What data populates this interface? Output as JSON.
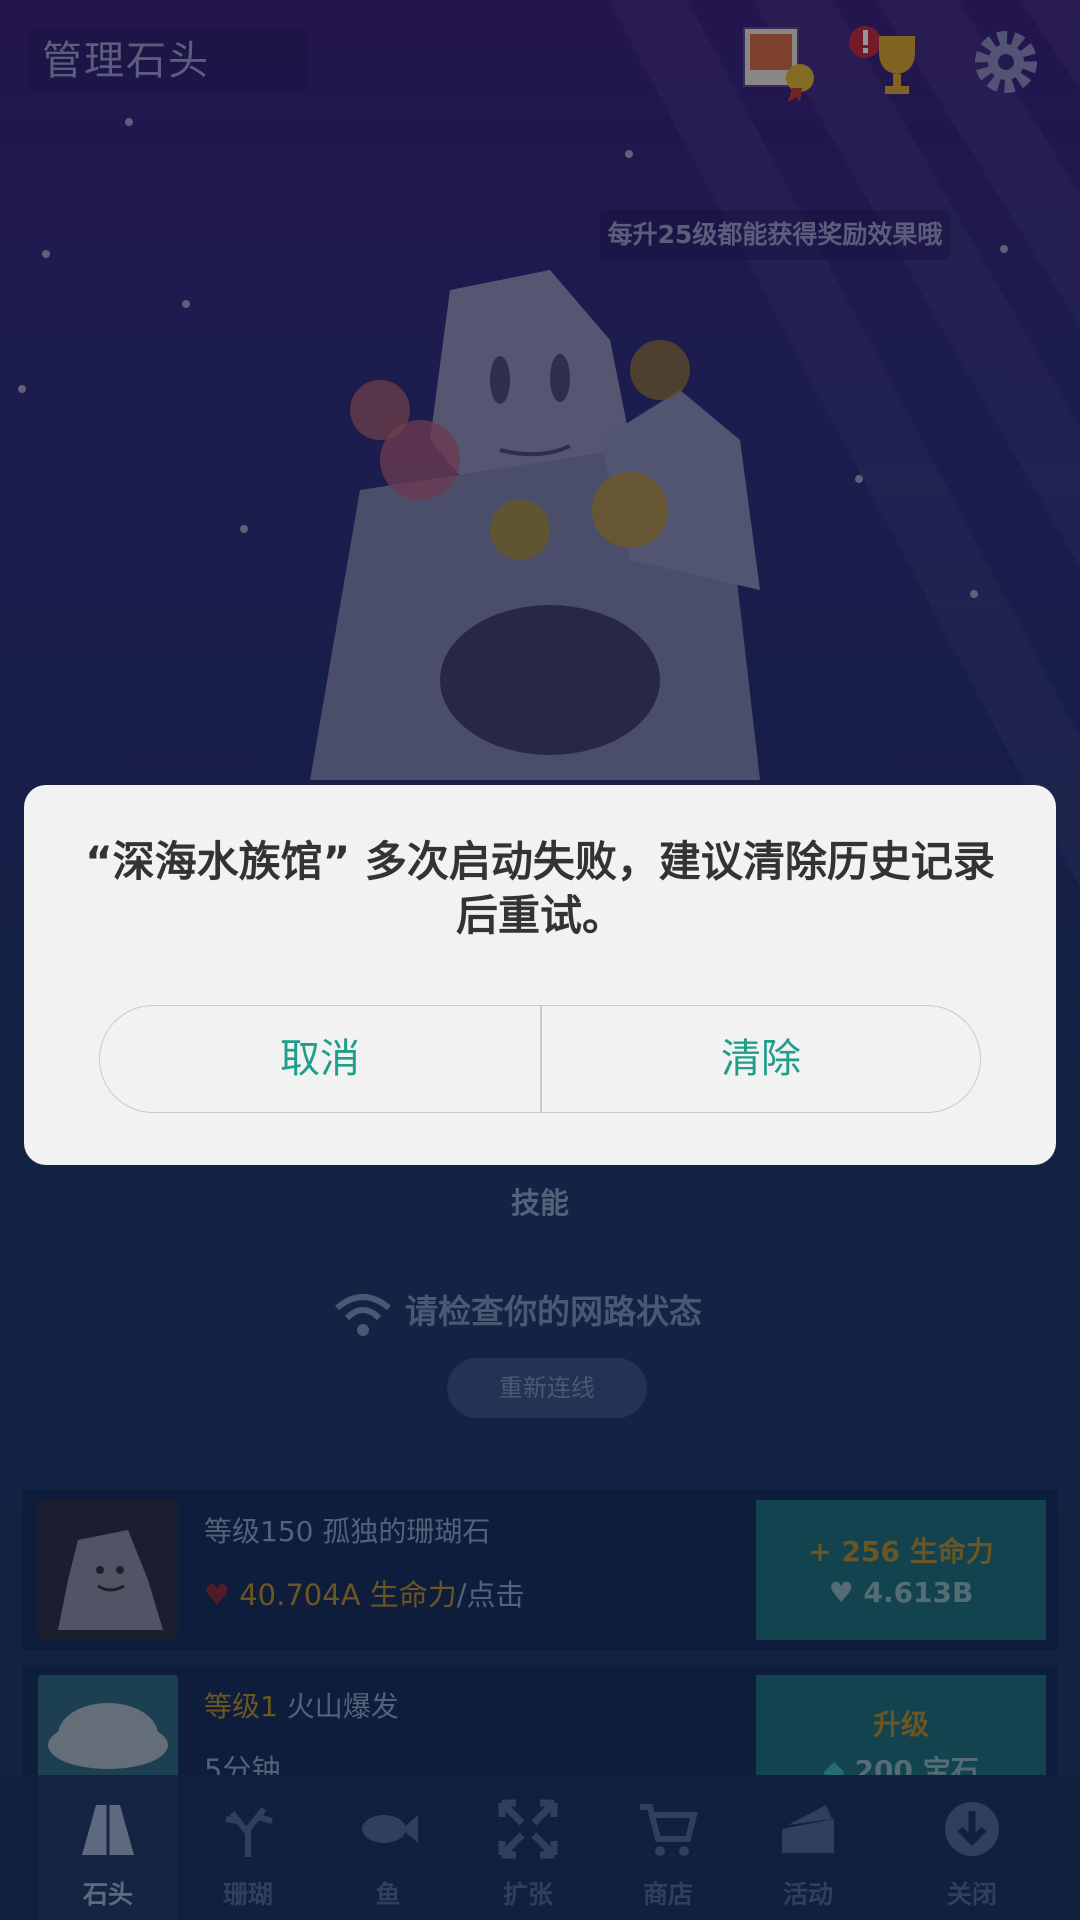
{
  "topbar": {
    "title": "管理石头"
  },
  "hint": "每升25级都能获得奖励效果哦",
  "panel": {
    "title": "技能",
    "network_text": "请检查你的网路状态",
    "reconnect_label": "重新连线"
  },
  "rows": [
    {
      "name": "等级150 孤独的珊瑚石",
      "stat_value": "40.704A 生命力",
      "stat_suffix": "/点击",
      "button_line1": "+ 256 生命力",
      "button_line2": "♥ 4.613B"
    },
    {
      "level": "等级1",
      "name": " 火山爆发",
      "sub": "5分钟",
      "button_line1": "升级",
      "button_line2": "200 宝石"
    }
  ],
  "bottom_nav": [
    {
      "label": "石头",
      "icon": "rock-icon",
      "active": true
    },
    {
      "label": "珊瑚",
      "icon": "coral-icon"
    },
    {
      "label": "鱼",
      "icon": "fish-icon"
    },
    {
      "label": "扩张",
      "icon": "expand-icon"
    },
    {
      "label": "商店",
      "icon": "cart-icon"
    },
    {
      "label": "活动",
      "icon": "event-icon"
    },
    {
      "label": "关闭",
      "icon": "download-icon"
    }
  ],
  "dialog": {
    "message": "“深海水族馆” 多次启动失败，建议清除历史记录后重试。",
    "cancel_label": "取消",
    "clear_label": "清除"
  },
  "colors": {
    "accent": "#1f9e8a",
    "dialog_bg": "#f2f2f3",
    "text": "#333333"
  }
}
